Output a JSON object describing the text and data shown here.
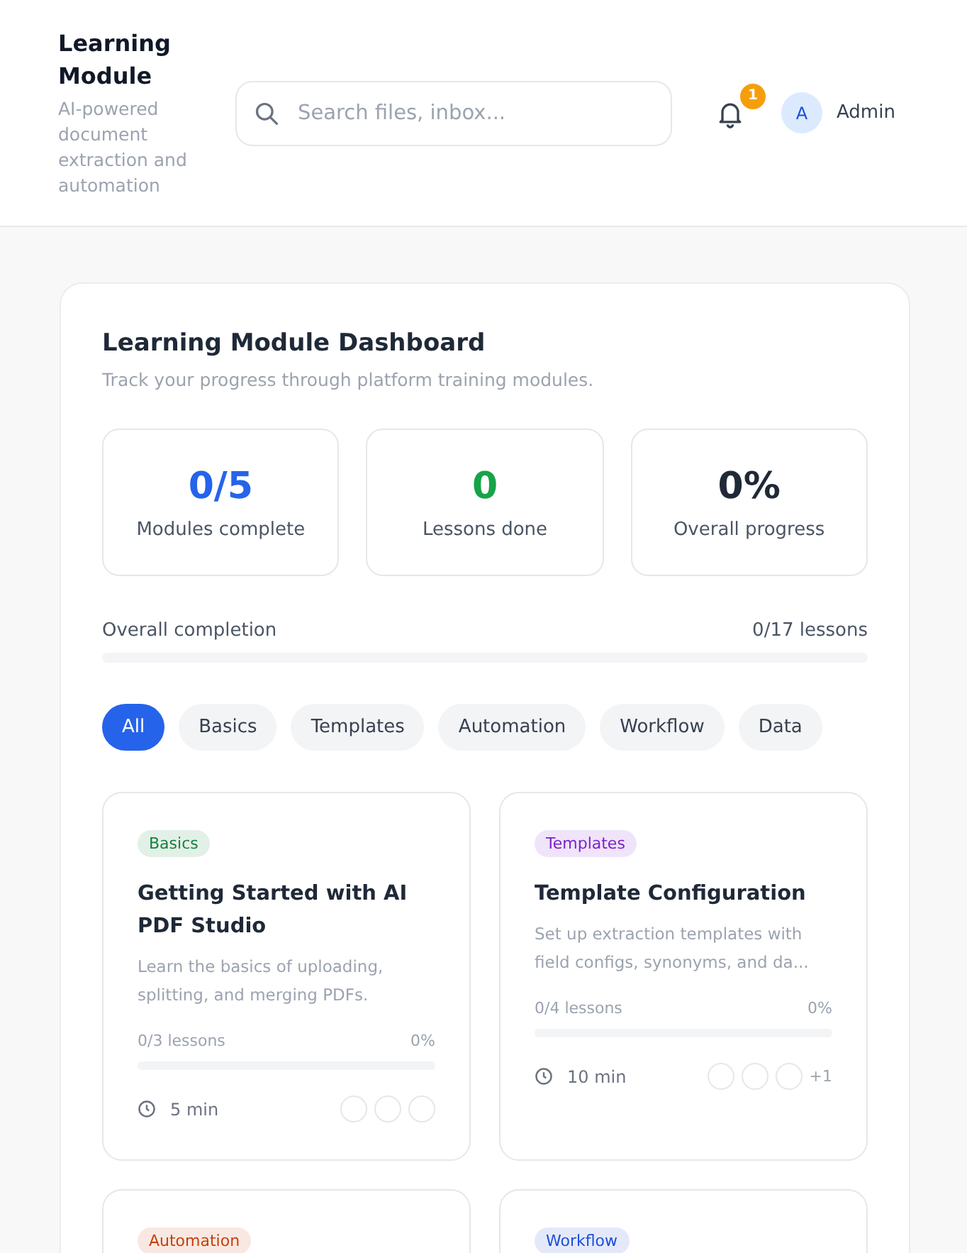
{
  "header": {
    "title": "Learning Module",
    "subtitle": "AI-powered document extraction and automation",
    "search": {
      "placeholder": "Search files, inbox..."
    },
    "notifications": {
      "badge": "1"
    },
    "user": {
      "initial": "A",
      "name": "Admin"
    }
  },
  "dashboard": {
    "title": "Learning Module Dashboard",
    "subtitle": "Track your progress through platform training modules.",
    "stats": [
      {
        "value": "0/5",
        "label": "Modules complete",
        "color": "#2563eb"
      },
      {
        "value": "0",
        "label": "Lessons done",
        "color": "#16a34a"
      },
      {
        "value": "0%",
        "label": "Overall progress",
        "color": "#1f2937"
      }
    ],
    "completion": {
      "label": "Overall completion",
      "reading": "0/17 lessons",
      "level": 0
    },
    "filters": [
      {
        "label": "All",
        "selected": true
      },
      {
        "label": "Basics",
        "selected": false
      },
      {
        "label": "Templates",
        "selected": false
      },
      {
        "label": "Automation",
        "selected": false
      },
      {
        "label": "Workflow",
        "selected": false
      },
      {
        "label": "Data",
        "selected": false
      }
    ],
    "modules": [
      {
        "tag": "Basics",
        "color": "#15803d",
        "title": "Getting Started with AI PDF Studio",
        "description": "Learn the basics of uploading, splitting, and merging PDFs.",
        "lessons": "0/3 lessons",
        "percent": "0%",
        "level": 0,
        "duration": "5 min",
        "lesson_dots": [
          {
            "done": false
          },
          {
            "done": false
          },
          {
            "done": false
          }
        ]
      },
      {
        "tag": "Templates",
        "color": "#7e22ce",
        "title": "Template Configuration",
        "description": "Set up extraction templates with field configs, synonyms, and da...",
        "lessons": "0/4 lessons",
        "percent": "0%",
        "level": 0,
        "duration": "10 min",
        "lesson_dots": [
          {
            "done": false
          },
          {
            "done": false
          },
          {
            "done": false
          }
        ],
        "more": "+1"
      },
      {
        "tag": "Automation",
        "color": "#c2410c"
      },
      {
        "tag": "Workflow",
        "color": "#1d4ed8"
      }
    ]
  }
}
